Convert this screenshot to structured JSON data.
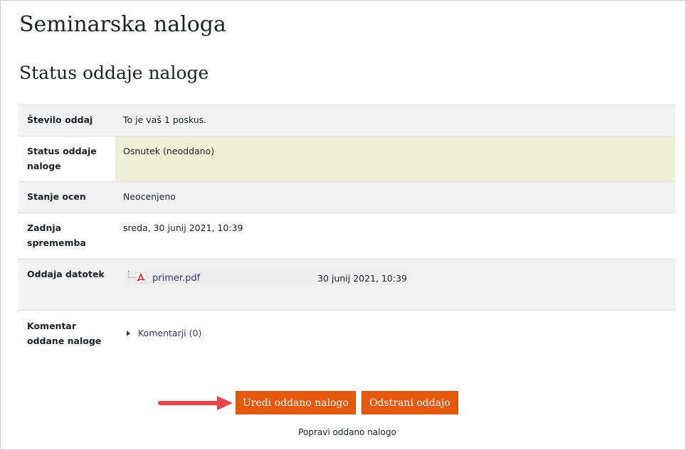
{
  "page": {
    "title": "Seminarska naloga",
    "section_title": "Status oddaje naloge"
  },
  "status_table": {
    "rows": [
      {
        "label": "Število oddaj",
        "value": "To je vaš 1 poskus."
      },
      {
        "label": "Status oddaje naloge",
        "value": "Osnutek (neoddano)"
      },
      {
        "label": "Stanje ocen",
        "value": "Neocenjeno"
      },
      {
        "label": "Zadnja sprememba",
        "value": "sreda, 30 junij 2021, 10:39"
      },
      {
        "label": "Oddaja datotek",
        "file": {
          "name": "primer.pdf",
          "date": "30 junij 2021, 10:39",
          "icon": "pdf-icon"
        }
      },
      {
        "label": "Komentar oddane naloge",
        "link": "Komentarji (0)"
      }
    ]
  },
  "actions": {
    "edit_label": "Uredi oddano nalogo",
    "remove_label": "Odstrani oddajo",
    "hint": "Popravi oddano nalogo"
  },
  "colors": {
    "button": "#e6590d",
    "link": "#3d3476",
    "draft_background": "#eef0d6",
    "arrow": "#e8464a"
  }
}
